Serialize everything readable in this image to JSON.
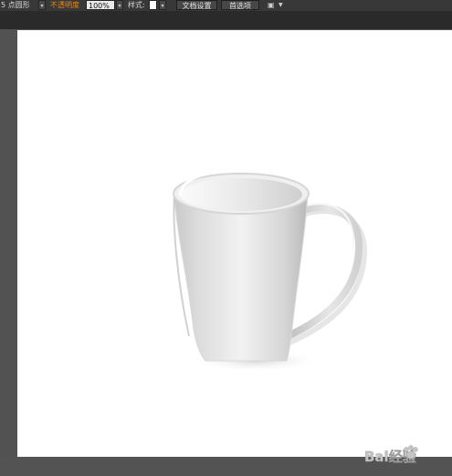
{
  "control_bar": {
    "shape_value": "5 点圆形",
    "opacity_label": "不透明度",
    "opacity_value": "100%",
    "style_label": "样式:",
    "document_setup_button": "文档设置",
    "preferences_button": "首选项",
    "arrange_icon": "arrange-documents-icon",
    "dropdown_icon": "chevron-down-icon"
  },
  "canvas": {
    "artwork": "coffee-mug-illustration",
    "watermark_text": "Bai经验",
    "watermark_icon": "paw-logo-icon"
  },
  "colors": {
    "control_bar_bg": "#383838",
    "workspace_bg": "#525252",
    "artboard_bg": "#ffffff",
    "opacity_label": "#e8891a"
  }
}
